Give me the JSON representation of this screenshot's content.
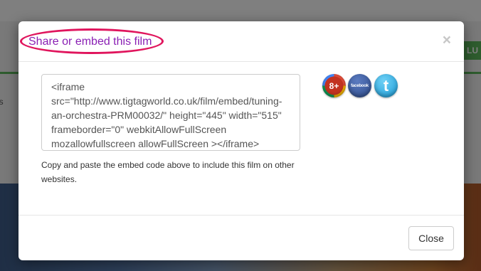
{
  "background_page": {
    "green_button_text": "LU",
    "side_text": "es"
  },
  "modal": {
    "title": "Share or embed this film",
    "close_symbol": "×",
    "embed_code": "<iframe\nsrc=\"http://www.tigtagworld.co.uk/film/embed/tuning-\nan-orchestra-PRM00032/\" height=\"445\" width=\"515\"\nframeborder=\"0\" webkitAllowFullScreen\nmozallowfullscreen allowFullScreen ></iframe>",
    "social": {
      "google_plus": "8+",
      "facebook": "facebook",
      "twitter": "t"
    },
    "help_text": "Copy and paste the embed code above to include this film on other websites.",
    "close_button": "Close"
  },
  "colors": {
    "title": "#8a1fb4",
    "highlight_ring": "#e0155d",
    "accent_green": "#5cb85c"
  }
}
